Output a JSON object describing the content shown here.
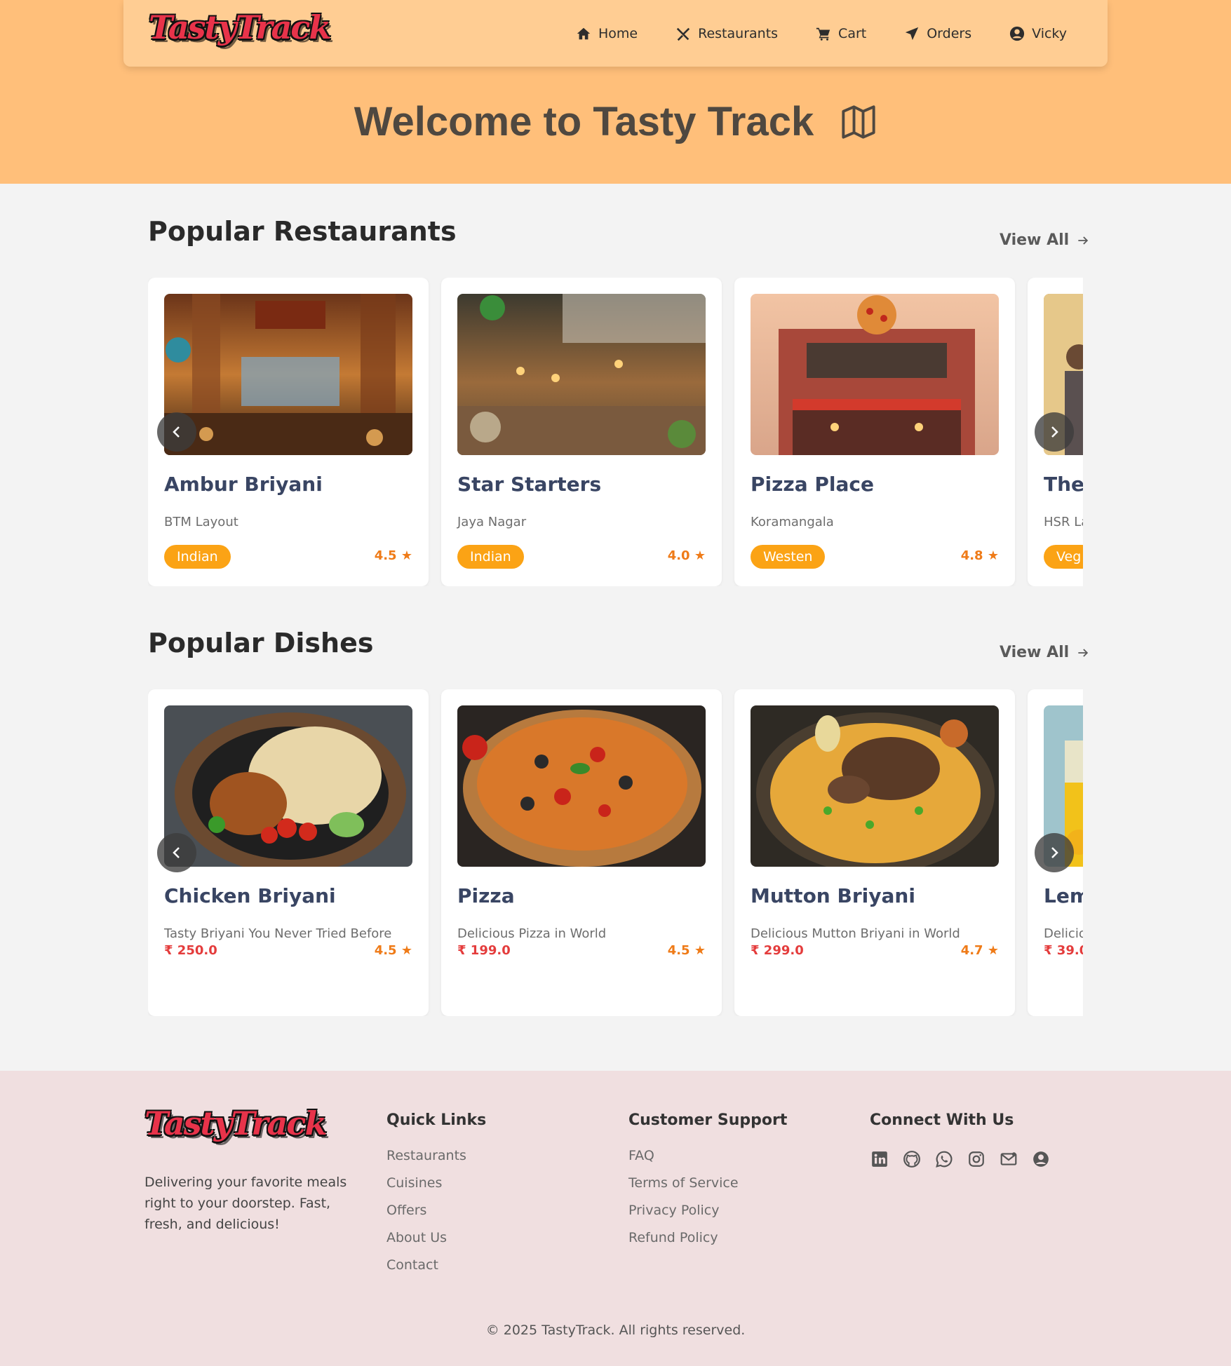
{
  "brand": "TastyTrack",
  "nav": {
    "items": [
      {
        "label": "Home",
        "icon": "home-icon"
      },
      {
        "label": "Restaurants",
        "icon": "utensils-icon"
      },
      {
        "label": "Cart",
        "icon": "cart-icon"
      },
      {
        "label": "Orders",
        "icon": "send-icon"
      },
      {
        "label": "Vicky",
        "icon": "user-circle-icon"
      }
    ]
  },
  "hero": {
    "title": "Welcome to Tasty Track",
    "icon": "map-icon"
  },
  "restaurants": {
    "title": "Popular Restaurants",
    "view_all": "View All",
    "items": [
      {
        "name": "Ambur Briyani",
        "location": "BTM Layout",
        "cuisine": "Indian",
        "rating": "4.5"
      },
      {
        "name": "Star Starters",
        "location": "Jaya Nagar",
        "cuisine": "Indian",
        "rating": "4.0"
      },
      {
        "name": "Pizza Place",
        "location": "Koramangala",
        "cuisine": "Westen",
        "rating": "4.8"
      },
      {
        "name": "The",
        "location": "HSR La",
        "cuisine": "Veg",
        "rating": ""
      }
    ]
  },
  "dishes": {
    "title": "Popular Dishes",
    "view_all": "View All",
    "items": [
      {
        "name": "Chicken Briyani",
        "description": "Tasty Briyani You Never Tried Before",
        "price": "₹ 250.0",
        "rating": "4.5"
      },
      {
        "name": "Pizza",
        "description": "Delicious Pizza in World",
        "price": "₹ 199.0",
        "rating": "4.5"
      },
      {
        "name": "Mutton Briyani",
        "description": "Delicious Mutton Briyani in World",
        "price": "₹ 299.0",
        "rating": "4.7"
      },
      {
        "name": "Lem",
        "description": "Delicio",
        "price": "₹ 39.0",
        "rating": ""
      }
    ]
  },
  "footer": {
    "tagline": "Delivering your favorite meals right to your doorstep. Fast, fresh, and delicious!",
    "quick_links": {
      "title": "Quick Links",
      "items": [
        "Restaurants",
        "Cuisines",
        "Offers",
        "About Us",
        "Contact"
      ]
    },
    "support": {
      "title": "Customer Support",
      "items": [
        "FAQ",
        "Terms of Service",
        "Privacy Policy",
        "Refund Policy"
      ]
    },
    "connect": {
      "title": "Connect With Us",
      "icons": [
        "linkedin-icon",
        "github-icon",
        "whatsapp-icon",
        "instagram-icon",
        "mail-icon",
        "user-circle-icon"
      ]
    },
    "copyright": "© 2025 TastyTrack. All rights reserved."
  },
  "colors": {
    "hero_bg": "#ffbf7a",
    "navbar_bg": "#ffcd93",
    "tag": "#fba315",
    "rating": "#ef7b18",
    "price": "#e43c3c",
    "footer_bg": "#f0dfe0"
  }
}
